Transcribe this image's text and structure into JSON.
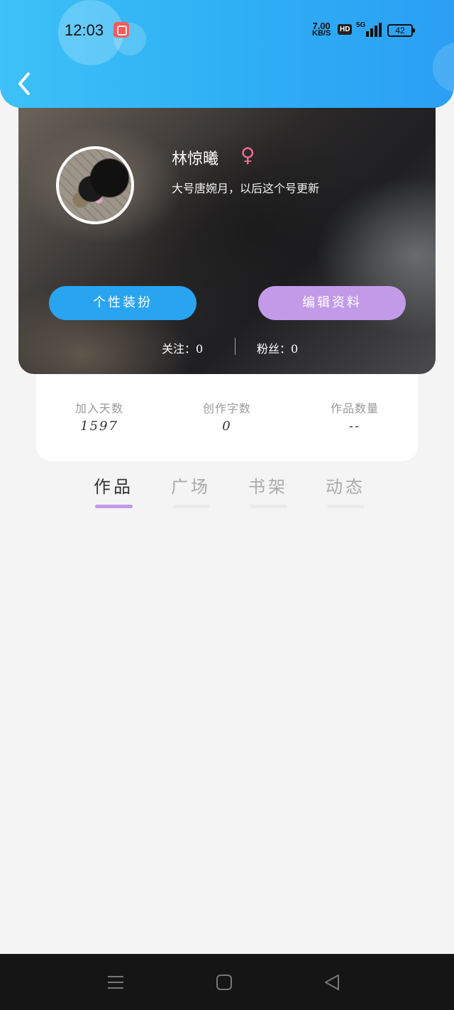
{
  "status_bar": {
    "time": "12:03",
    "net_speed_value": "7.00",
    "net_speed_unit": "KB/S",
    "hd_label": "HD",
    "network_label": "5G",
    "battery": "42"
  },
  "profile": {
    "name": "林惊曦",
    "gender_symbol": "♀",
    "bio": "大号唐婉月，以后这个号更新",
    "dress_button": "个性装扮",
    "edit_button": "编辑资料",
    "following": "关注：0",
    "fans": "粉丝：0"
  },
  "stats": [
    {
      "label": "加入天数",
      "value": "1597"
    },
    {
      "label": "创作字数",
      "value": "0"
    },
    {
      "label": "作品数量",
      "value": "--"
    }
  ],
  "tabs": [
    {
      "label": "作品",
      "active": true
    },
    {
      "label": "广场",
      "active": false
    },
    {
      "label": "书架",
      "active": false
    },
    {
      "label": "动态",
      "active": false
    }
  ],
  "colors": {
    "header_blue": "#2fb0f5",
    "accent_purple": "#c39ae8",
    "button_blue": "#29a4f0",
    "gender_pink": "#f06a92"
  }
}
